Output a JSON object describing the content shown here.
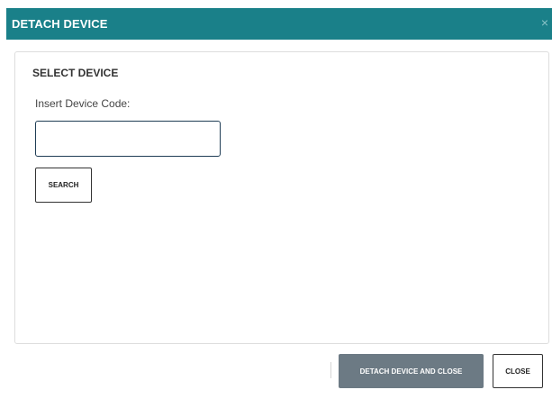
{
  "dialog": {
    "title": "DETACH DEVICE",
    "close_icon_glyph": "×",
    "accent_color": "#1a8089"
  },
  "panel": {
    "section_title": "SELECT DEVICE",
    "field_label": "Insert Device Code:",
    "device_code_value": "",
    "search_label": "SEARCH"
  },
  "footer": {
    "detach_label": "DETACH DEVICE AND CLOSE",
    "close_label": "CLOSE"
  }
}
